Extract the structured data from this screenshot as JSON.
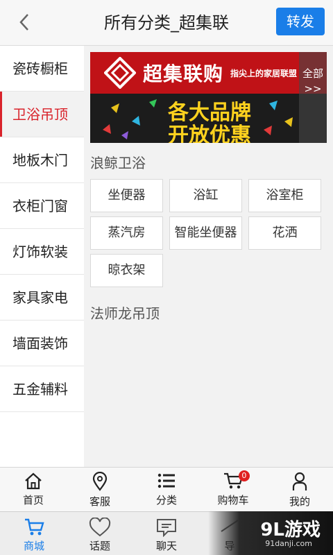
{
  "header": {
    "title": "所有分类_超集联",
    "share_label": "转发"
  },
  "sidebar": {
    "items": [
      {
        "label": "瓷砖橱柜",
        "active": false
      },
      {
        "label": "卫浴吊顶",
        "active": true
      },
      {
        "label": "地板木门",
        "active": false
      },
      {
        "label": "衣柜门窗",
        "active": false
      },
      {
        "label": "灯饰软装",
        "active": false
      },
      {
        "label": "家具家电",
        "active": false
      },
      {
        "label": "墙面装饰",
        "active": false
      },
      {
        "label": "五金辅料",
        "active": false
      }
    ]
  },
  "banner": {
    "brand": "超集联购",
    "slogan": "指尖上的家居联盟",
    "promo_line1": "各大品牌",
    "promo_line2": "开放优惠",
    "all_label": "全部>>"
  },
  "sections": [
    {
      "title": "浪鲸卫浴",
      "items": [
        "坐便器",
        "浴缸",
        "浴室柜",
        "蒸汽房",
        "智能坐便器",
        "花洒",
        "晾衣架"
      ]
    },
    {
      "title": "法师龙吊顶",
      "items": []
    }
  ],
  "bottom_nav": {
    "items": [
      {
        "label": "首页",
        "icon": "home-icon"
      },
      {
        "label": "客服",
        "icon": "location-pin-icon"
      },
      {
        "label": "分类",
        "icon": "list-icon"
      },
      {
        "label": "购物车",
        "icon": "cart-icon",
        "badge": "0"
      },
      {
        "label": "我的",
        "icon": "user-icon"
      }
    ]
  },
  "system_bar": {
    "items": [
      {
        "label": "商城",
        "icon": "cart-icon",
        "active": true
      },
      {
        "label": "话题",
        "icon": "heart-icon"
      },
      {
        "label": "聊天",
        "icon": "chat-icon"
      },
      {
        "label": "导",
        "icon": "nav-icon"
      }
    ]
  },
  "watermark": {
    "logo": "9L游戏",
    "url": "91danji.com"
  },
  "colors": {
    "accent": "#1a7ee8",
    "active_red": "#d9232b",
    "banner_red": "#c01217",
    "promo_yellow": "#ffd21e"
  }
}
